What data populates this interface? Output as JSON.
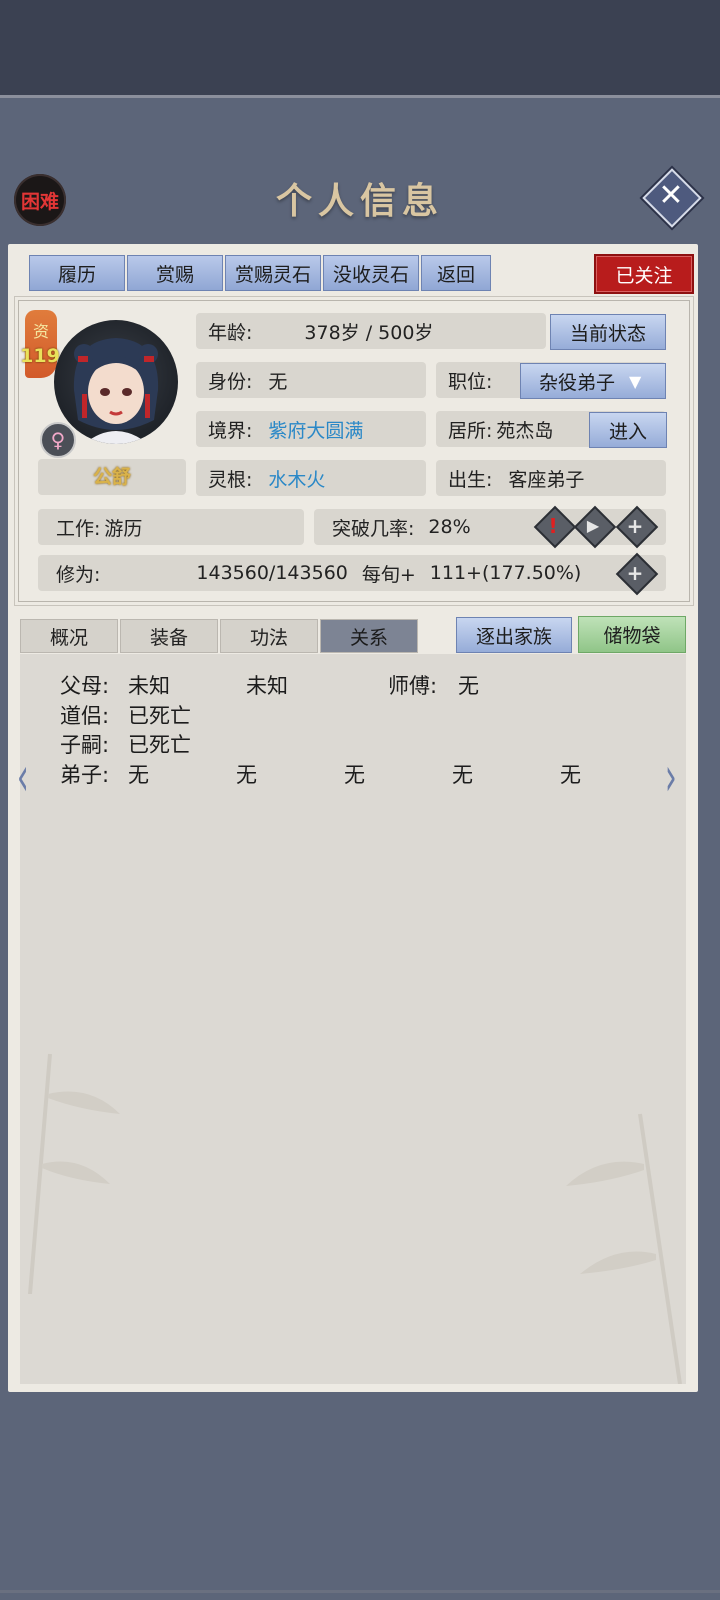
{
  "header": {
    "title": "个人信息",
    "difficulty": "困难"
  },
  "top_tabs": [
    "履历",
    "赏赐",
    "赏赐灵石",
    "没收灵石",
    "返回"
  ],
  "follow_label": "已关注",
  "profile": {
    "aptitude_label": "资",
    "aptitude_value": "119",
    "name": "公舒",
    "gender_icon": "female-icon",
    "age_label": "年龄:",
    "age_value": "378岁 / 500岁",
    "status_button": "当前状态",
    "identity_label": "身份:",
    "identity_value": "无",
    "position_label": "职位:",
    "position_value": "杂役弟子",
    "realm_label": "境界:",
    "realm_value": "紫府大圆满",
    "residence_label": "居所:",
    "residence_value": "苑杰岛",
    "enter_button": "进入",
    "root_label": "灵根:",
    "root_value": "水木火",
    "birth_label": "出生:",
    "birth_value": "客座弟子",
    "work_label": "工作:",
    "work_value": "游历",
    "breakthrough_label": "突破几率:",
    "breakthrough_value": "28%",
    "cultivation_label": "修为:",
    "cultivation_value": "143560/143560",
    "per_period_label": "每旬+",
    "per_period_value": "111+(177.50%)"
  },
  "section_tabs": [
    "概况",
    "装备",
    "功法",
    "关系"
  ],
  "active_section": "关系",
  "expel_button": "逐出家族",
  "bag_button": "储物袋",
  "relations": {
    "parents_label": "父母:",
    "parent1": "未知",
    "parent2": "未知",
    "master_label": "师傅:",
    "master_value": "无",
    "partner_label": "道侣:",
    "partner_value": "已死亡",
    "children_label": "子嗣:",
    "children_value": "已死亡",
    "disciples_label": "弟子:",
    "disciples": [
      "无",
      "无",
      "无",
      "无",
      "无"
    ]
  },
  "colors": {
    "accent_blue": "#2a88c7",
    "follow_red": "#b81c1c",
    "title_gold": "#d9c6a2"
  }
}
